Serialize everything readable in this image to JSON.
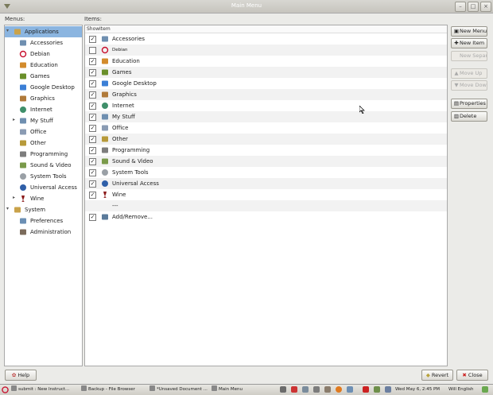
{
  "window": {
    "title": "Main Menu"
  },
  "labels": {
    "menus": "Menus:",
    "items": "Items:"
  },
  "items_header": {
    "show": "Show",
    "item": "Item"
  },
  "menus_tree": [
    {
      "label": "Applications",
      "level": 0,
      "expander": "▾",
      "icon": "applications-icon",
      "selected": true
    },
    {
      "label": "Accessories",
      "level": 1,
      "icon": "accessories-icon"
    },
    {
      "label": "Debian",
      "level": 1,
      "icon": "debian-icon"
    },
    {
      "label": "Education",
      "level": 1,
      "icon": "education-icon"
    },
    {
      "label": "Games",
      "level": 1,
      "icon": "games-icon"
    },
    {
      "label": "Google Desktop",
      "level": 1,
      "icon": "google-desktop-icon"
    },
    {
      "label": "Graphics",
      "level": 1,
      "icon": "graphics-icon"
    },
    {
      "label": "Internet",
      "level": 1,
      "icon": "internet-icon"
    },
    {
      "label": "My Stuff",
      "level": 1,
      "expander": "▸",
      "icon": "my-stuff-icon"
    },
    {
      "label": "Office",
      "level": 1,
      "icon": "office-icon"
    },
    {
      "label": "Other",
      "level": 1,
      "icon": "other-icon"
    },
    {
      "label": "Programming",
      "level": 1,
      "icon": "programming-icon"
    },
    {
      "label": "Sound & Video",
      "level": 1,
      "icon": "sound-video-icon"
    },
    {
      "label": "System Tools",
      "level": 1,
      "icon": "system-tools-icon"
    },
    {
      "label": "Universal Access",
      "level": 1,
      "icon": "universal-access-icon"
    },
    {
      "label": "Wine",
      "level": 1,
      "expander": "▸",
      "icon": "wine-icon"
    },
    {
      "label": "System",
      "level": 0,
      "expander": "▾",
      "icon": "system-icon"
    },
    {
      "label": "Preferences",
      "level": 1,
      "icon": "preferences-icon"
    },
    {
      "label": "Administration",
      "level": 1,
      "icon": "administration-icon"
    }
  ],
  "items_list": [
    {
      "label": "Accessories",
      "show": true,
      "icon": "accessories-icon"
    },
    {
      "label": "Debian",
      "show": false,
      "icon": "debian-icon",
      "small": true
    },
    {
      "label": "Education",
      "show": true,
      "icon": "education-icon"
    },
    {
      "label": "Games",
      "show": true,
      "icon": "games-icon"
    },
    {
      "label": "Google Desktop",
      "show": true,
      "icon": "google-desktop-icon"
    },
    {
      "label": "Graphics",
      "show": true,
      "icon": "graphics-icon"
    },
    {
      "label": "Internet",
      "show": true,
      "icon": "internet-icon"
    },
    {
      "label": "My Stuff",
      "show": true,
      "icon": "my-stuff-icon"
    },
    {
      "label": "Office",
      "show": true,
      "icon": "office-icon"
    },
    {
      "label": "Other",
      "show": true,
      "icon": "other-icon"
    },
    {
      "label": "Programming",
      "show": true,
      "icon": "programming-icon"
    },
    {
      "label": "Sound & Video",
      "show": true,
      "icon": "sound-video-icon"
    },
    {
      "label": "System Tools",
      "show": true,
      "icon": "system-tools-icon"
    },
    {
      "label": "Universal Access",
      "show": true,
      "icon": "universal-access-icon"
    },
    {
      "label": "Wine",
      "show": true,
      "icon": "wine-icon"
    },
    {
      "label": "---",
      "show": null,
      "icon": ""
    },
    {
      "label": "Add/Remove...",
      "show": true,
      "icon": "add-remove-icon"
    }
  ],
  "side_buttons": [
    {
      "label": "New Menu",
      "icon": "new-menu-icon",
      "glyph": "▣",
      "enabled": true
    },
    {
      "label": "New Item",
      "icon": "new-item-icon",
      "glyph": "✚",
      "enabled": true
    },
    {
      "label": "New Separator",
      "icon": "",
      "glyph": "",
      "enabled": false
    },
    {
      "label": "Move Up",
      "icon": "move-up-icon",
      "glyph": "▲",
      "enabled": false
    },
    {
      "label": "Move Down",
      "icon": "move-down-icon",
      "glyph": "▼",
      "enabled": false
    },
    {
      "label": "Properties",
      "icon": "properties-icon",
      "glyph": "▤",
      "enabled": true
    },
    {
      "label": "Delete",
      "icon": "delete-icon",
      "glyph": "▥",
      "enabled": true
    }
  ],
  "bottom_buttons": {
    "help": "Help",
    "revert": "Revert",
    "close": "Close"
  },
  "taskbar": {
    "tasks": [
      {
        "label": "submit : New Instruct...",
        "icon": "browser-icon"
      },
      {
        "label": "Backup - File Browser",
        "icon": "folder-icon"
      },
      {
        "label": "*Unsaved Document ...",
        "icon": "text-editor-icon"
      },
      {
        "label": "Main Menu",
        "icon": "menu-editor-icon"
      }
    ],
    "clock": "Wed May 6,  2:45 PM",
    "keyboard": "Will English"
  },
  "colors": {
    "selection": "#8bb5e0",
    "background": "#ebebe8",
    "pane_border": "#a9a9a9"
  }
}
